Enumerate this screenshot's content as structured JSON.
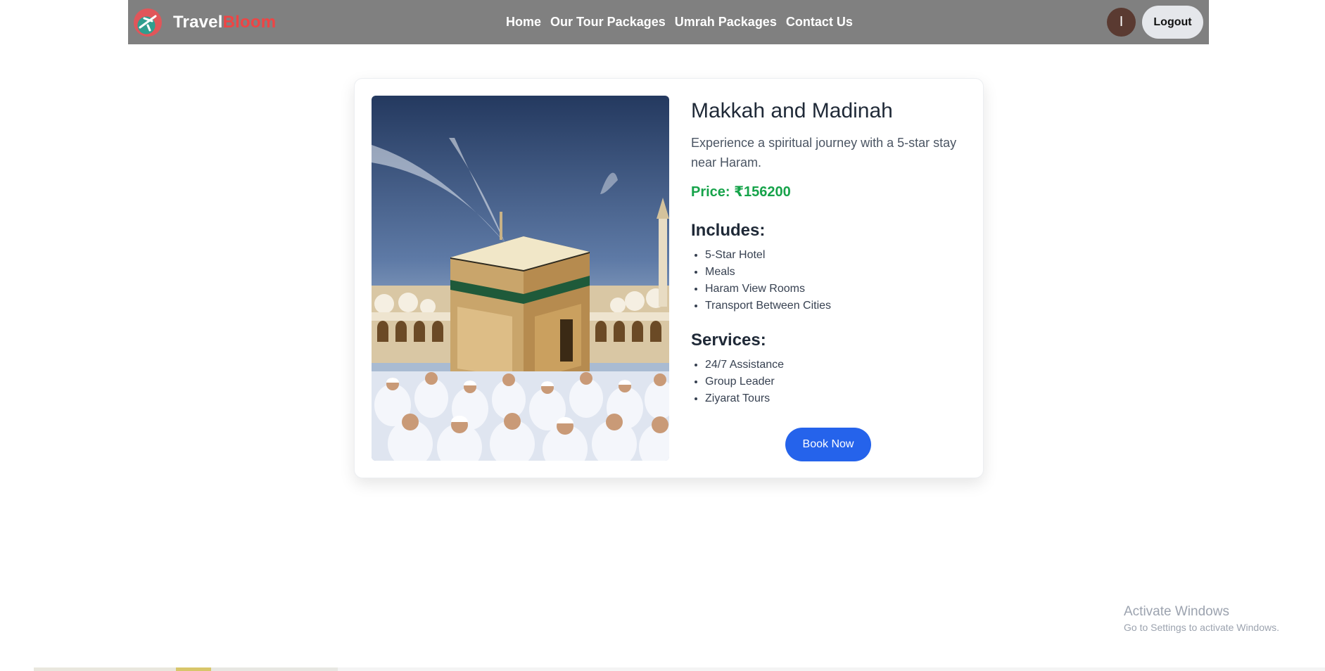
{
  "navbar": {
    "brand_first": "Travel",
    "brand_second": "Bloom",
    "links": [
      "Home",
      "Our Tour Packages",
      "Umrah Packages",
      "Contact Us"
    ],
    "avatar_initial": "I",
    "logout_label": "Logout"
  },
  "package": {
    "title": "Makkah and Madinah",
    "description": "Experience a spiritual journey with a 5-star stay near Haram.",
    "price_text": "Price: ₹156200",
    "includes_heading": "Includes:",
    "includes": [
      "5-Star Hotel",
      "Meals",
      "Haram View Rooms",
      "Transport Between Cities"
    ],
    "services_heading": "Services:",
    "services": [
      "24/7 Assistance",
      "Group Leader",
      "Ziyarat Tours"
    ],
    "book_label": "Book Now"
  },
  "watermark": {
    "title": "Activate Windows",
    "subtitle": "Go to Settings to activate Windows."
  },
  "colors": {
    "navbar_bg": "#808080",
    "brand_accent": "#ef4444",
    "price": "#16a34a",
    "primary_button": "#2563eb",
    "avatar_bg": "#5a3a31"
  }
}
